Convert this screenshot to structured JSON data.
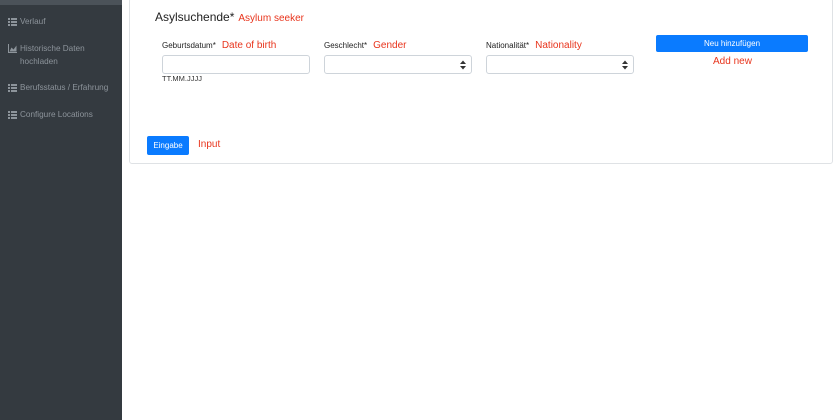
{
  "sidebar": {
    "items": [
      {
        "label": "Verlauf",
        "icon": "list-icon"
      },
      {
        "label": "Historische Daten hochladen",
        "icon": "chart-icon"
      },
      {
        "label": "Berufsstatus / Erfahrung",
        "icon": "list-icon"
      },
      {
        "label": "Configure Locations",
        "icon": "list-icon"
      }
    ]
  },
  "form": {
    "title": "Asylsuchende*",
    "title_annotation": "Asylum seeker",
    "fields": {
      "dob": {
        "label": "Geburtsdatum*",
        "annotation": "Date of birth",
        "value": "",
        "hint": "TT.MM.JJJJ"
      },
      "gender": {
        "label": "Geschlecht*",
        "annotation": "Gender",
        "value": ""
      },
      "nationality": {
        "label": "Nationalität*",
        "annotation": "Nationality",
        "value": ""
      }
    },
    "add_button_label": "Neu hinzufügen",
    "add_annotation": "Add new",
    "submit_button_label": "Eingabe",
    "submit_annotation": "Input"
  },
  "colors": {
    "sidebar_bg": "#343a40",
    "primary": "#0a7bff",
    "annotation": "#e8341c"
  }
}
